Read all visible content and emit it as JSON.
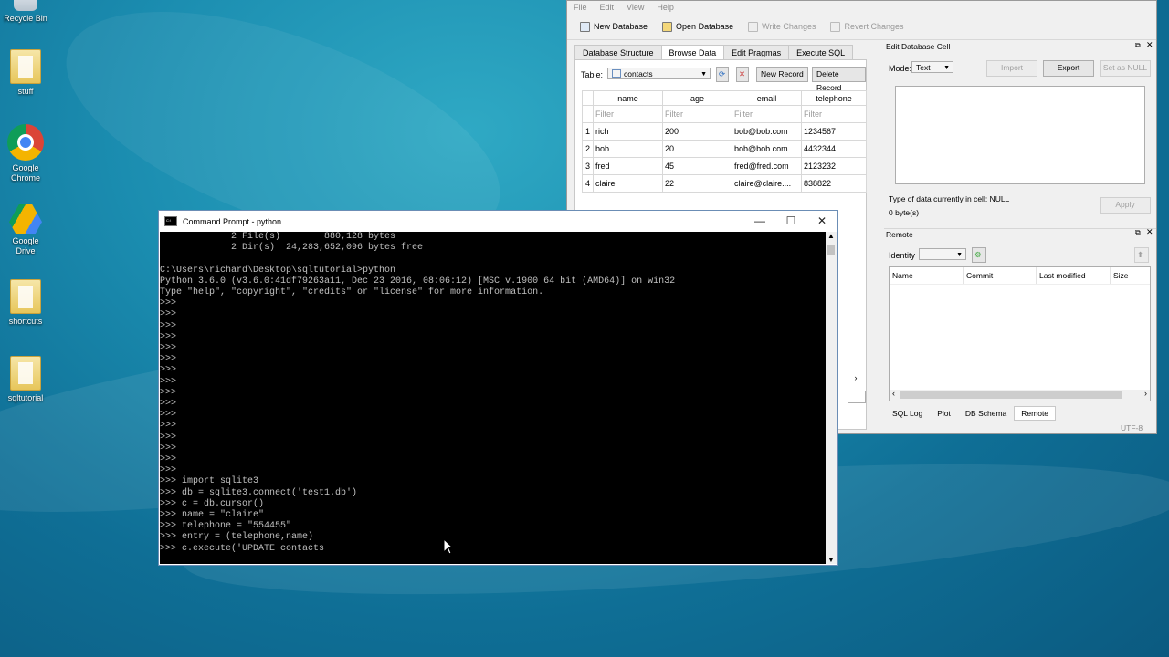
{
  "desktop": {
    "icons": [
      {
        "label": "Recycle Bin",
        "icon": "recycle-bin-icon"
      },
      {
        "label": "stuff",
        "icon": "folder-icon"
      },
      {
        "label": "Google Chrome",
        "icon": "chrome-icon"
      },
      {
        "label": "Google Drive",
        "icon": "google-drive-icon"
      },
      {
        "label": "shortcuts",
        "icon": "folder-icon"
      },
      {
        "label": "sqltutorial",
        "icon": "folder-icon"
      }
    ]
  },
  "dbbrowser": {
    "menu": [
      "File",
      "Edit",
      "View",
      "Help"
    ],
    "toolbar": {
      "new_db": "New Database",
      "open_db": "Open Database",
      "write": "Write Changes",
      "revert": "Revert Changes"
    },
    "tabs": [
      "Database Structure",
      "Browse Data",
      "Edit Pragmas",
      "Execute SQL"
    ],
    "active_tab": "Browse Data",
    "table_label": "Table:",
    "table_value": "contacts",
    "new_record": "New Record",
    "delete_record": "Delete Record",
    "columns": [
      "name",
      "age",
      "email",
      "telephone"
    ],
    "filter_placeholder": "Filter",
    "rows": [
      {
        "n": "1",
        "name": "rich",
        "age": "200",
        "email": "bob@bob.com",
        "telephone": "1234567"
      },
      {
        "n": "2",
        "name": "bob",
        "age": "20",
        "email": "bob@bob.com",
        "telephone": "4432344"
      },
      {
        "n": "3",
        "name": "fred",
        "age": "45",
        "email": "fred@fred.com",
        "telephone": "2123232"
      },
      {
        "n": "4",
        "name": "claire",
        "age": "22",
        "email": "claire@claire....",
        "telephone": "838822"
      }
    ],
    "edit_cell": {
      "title": "Edit Database Cell",
      "mode_label": "Mode:",
      "mode_value": "Text",
      "import": "Import",
      "export": "Export",
      "set_null": "Set as NULL",
      "type_info": "Type of data currently in cell: NULL",
      "size_info": "0 byte(s)",
      "apply": "Apply"
    },
    "remote": {
      "title": "Remote",
      "identity_label": "Identity",
      "columns": [
        "Name",
        "Commit",
        "Last modified",
        "Size"
      ]
    },
    "bottom_tabs": [
      "SQL Log",
      "Plot",
      "DB Schema",
      "Remote"
    ],
    "active_bottom_tab": "Remote",
    "encoding": "UTF-8"
  },
  "cmd": {
    "title": "Command Prompt - python",
    "lines": [
      "             2 File(s)        880,128 bytes",
      "             2 Dir(s)  24,283,652,096 bytes free",
      "",
      "C:\\Users\\richard\\Desktop\\sqltutorial>python",
      "Python 3.6.0 (v3.6.0:41df79263a11, Dec 23 2016, 08:06:12) [MSC v.1900 64 bit (AMD64)] on win32",
      "Type \"help\", \"copyright\", \"credits\" or \"license\" for more information.",
      ">>>",
      ">>>",
      ">>>",
      ">>>",
      ">>>",
      ">>>",
      ">>>",
      ">>>",
      ">>>",
      ">>>",
      ">>>",
      ">>>",
      ">>>",
      ">>>",
      ">>>",
      ">>>",
      ">>> import sqlite3",
      ">>> db = sqlite3.connect('test1.db')",
      ">>> c = db.cursor()",
      ">>> name = \"claire\"",
      ">>> telephone = \"554455\"",
      ">>> entry = (telephone,name)",
      ">>> c.execute('UPDATE contacts"
    ]
  }
}
